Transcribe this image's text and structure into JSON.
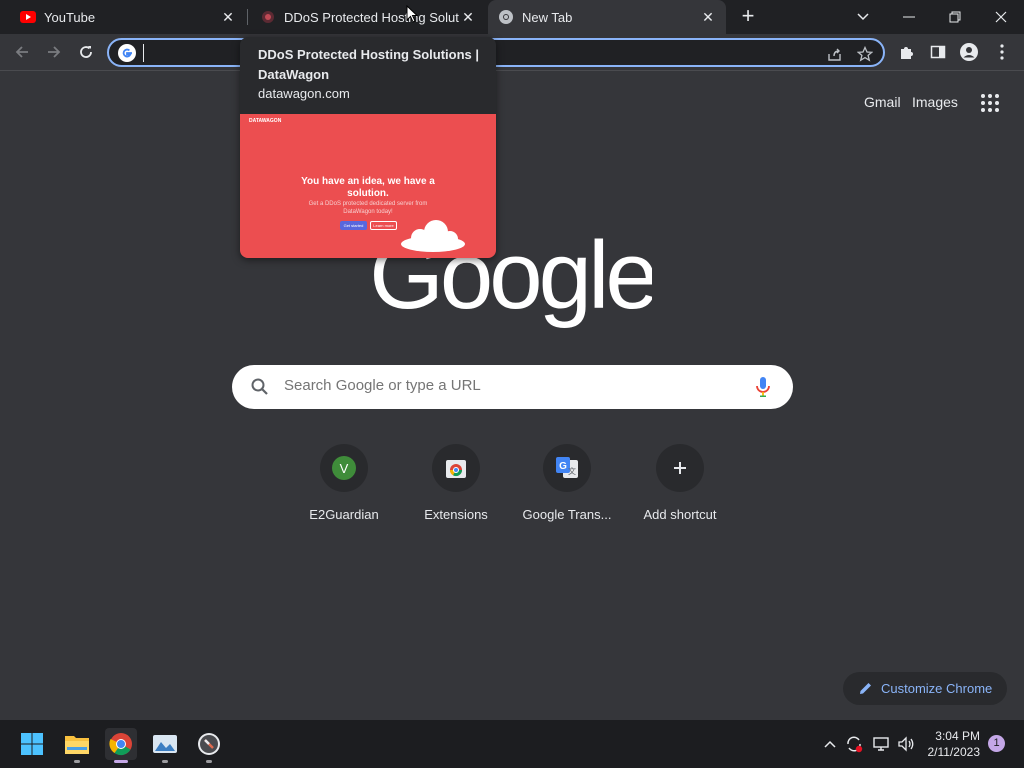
{
  "tabs": [
    {
      "title": "YouTube",
      "icon": "youtube-icon"
    },
    {
      "title": "DDoS Protected Hosting Solutions | DataWagon",
      "icon": "datawagon-icon"
    },
    {
      "title": "New Tab",
      "icon": "chrome-icon",
      "active": true
    }
  ],
  "omnibox": {
    "value": "",
    "placeholder": ""
  },
  "hover_card": {
    "title": "DDoS Protected Hosting Solutions | DataWagon",
    "domain": "datawagon.com",
    "preview": {
      "brand": "DATAWAGON",
      "headline": "You have an idea, we have a solution.",
      "subtext": "Get a DDoS protected dedicated server from DataWagon today!",
      "btn_primary": "Get started",
      "btn_secondary": "Learn more"
    }
  },
  "header": {
    "gmail": "Gmail",
    "images": "Images"
  },
  "logo": {
    "text": "Google"
  },
  "search": {
    "placeholder": "Search Google or type a URL"
  },
  "shortcuts": [
    {
      "label": "E2Guardian",
      "icon": "v-avatar-icon",
      "letter": "V"
    },
    {
      "label": "Extensions",
      "icon": "chrome-webstore-icon"
    },
    {
      "label": "Google Trans...",
      "icon": "google-translate-icon"
    },
    {
      "label": "Add shortcut",
      "icon": "plus-icon"
    }
  ],
  "customize": {
    "label": "Customize Chrome"
  },
  "taskbar": {
    "time": "3:04 PM",
    "date": "2/11/2023",
    "notifications": "1"
  },
  "colors": {
    "background": "#35363a",
    "accent": "#8ab4f8",
    "preview_bg": "#ec4e50"
  }
}
